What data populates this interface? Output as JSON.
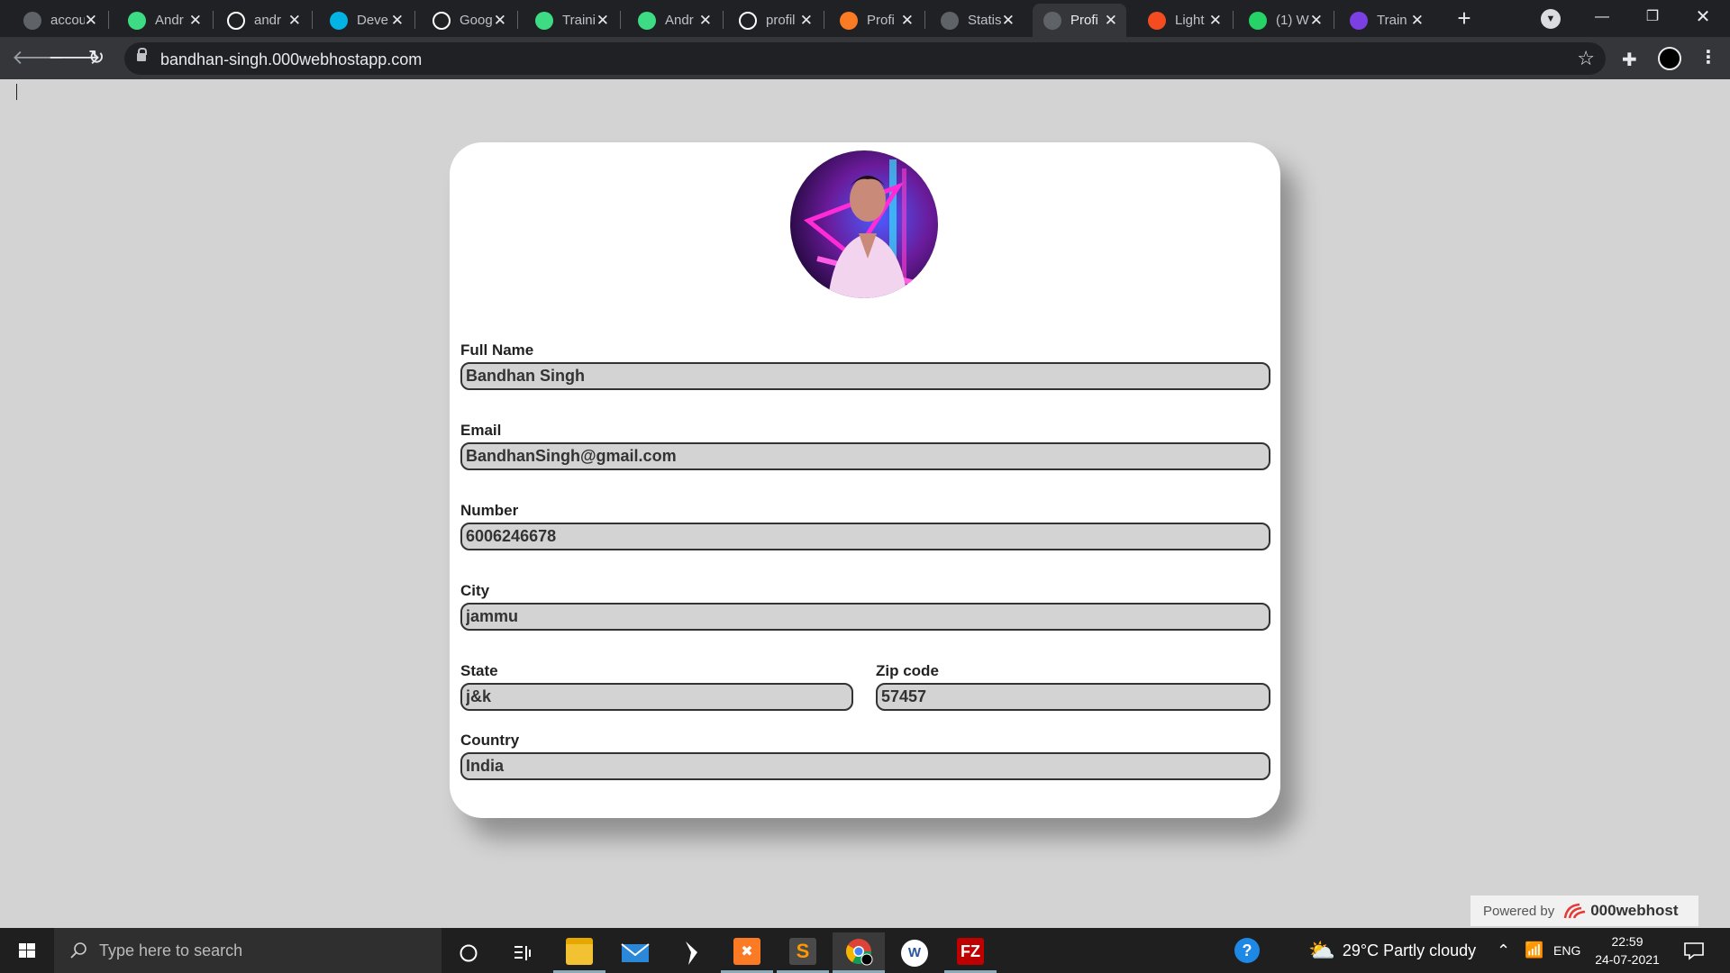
{
  "browser": {
    "tabs": [
      {
        "label": "accou",
        "icon": "globe-icon",
        "color": "#5f6368"
      },
      {
        "label": "Andr",
        "icon": "android-icon",
        "color": "#3ddc84"
      },
      {
        "label": "andr",
        "icon": "github-icon",
        "color": "#ffffff"
      },
      {
        "label": "Deve",
        "icon": "udacity-icon",
        "color": "#02b3e4"
      },
      {
        "label": "Goog",
        "icon": "google-codelabs-icon",
        "color": "#ffffff"
      },
      {
        "label": "Traini",
        "icon": "android-icon",
        "color": "#3ddc84"
      },
      {
        "label": "Andr",
        "icon": "android-icon",
        "color": "#3ddc84"
      },
      {
        "label": "profil",
        "icon": "github-icon",
        "color": "#ffffff"
      },
      {
        "label": "Profi",
        "icon": "xampp-icon",
        "color": "#fb7a24"
      },
      {
        "label": "Statis",
        "icon": "globe-icon",
        "color": "#5f6368"
      },
      {
        "label": "Profi",
        "icon": "globe-icon",
        "color": "#5f6368"
      },
      {
        "label": "Light",
        "icon": "lighthouse-icon",
        "color": "#f44b21"
      },
      {
        "label": "(1) W",
        "icon": "whatsapp-icon",
        "color": "#25d366"
      },
      {
        "label": "Train",
        "icon": "list-icon",
        "color": "#7b3fe4"
      }
    ],
    "active_tab_index": 10,
    "new_tab": "+",
    "url": "bandhan-singh.000webhostapp.com"
  },
  "form": {
    "full_name": {
      "label": "Full Name",
      "value": "Bandhan Singh"
    },
    "email": {
      "label": "Email",
      "value": "BandhanSingh@gmail.com"
    },
    "number": {
      "label": "Number",
      "value": "6006246678"
    },
    "city": {
      "label": "City",
      "value": "jammu"
    },
    "state": {
      "label": "State",
      "value": "j&k"
    },
    "zip": {
      "label": "Zip code",
      "value": "57457"
    },
    "country": {
      "label": "Country",
      "value": "India"
    }
  },
  "powered_by": {
    "prefix": "Powered by",
    "brand": "000webhost"
  },
  "taskbar": {
    "search_placeholder": "Type here to search",
    "weather": "29°C  Partly cloudy",
    "language": "ENG",
    "time": "22:59",
    "date": "24-07-2021",
    "apps": [
      "cortana",
      "task-view",
      "file-explorer",
      "mail",
      "visual-studio-code",
      "xampp",
      "sublime-text",
      "chrome",
      "word",
      "filezilla"
    ]
  },
  "colors": {
    "page_bg": "#d3d3d3",
    "card_bg": "#ffffff",
    "input_bg": "#d3d3d3",
    "chrome_dark": "#202124",
    "chrome_toolbar": "#35363a",
    "taskbar": "#1f1f1f"
  }
}
